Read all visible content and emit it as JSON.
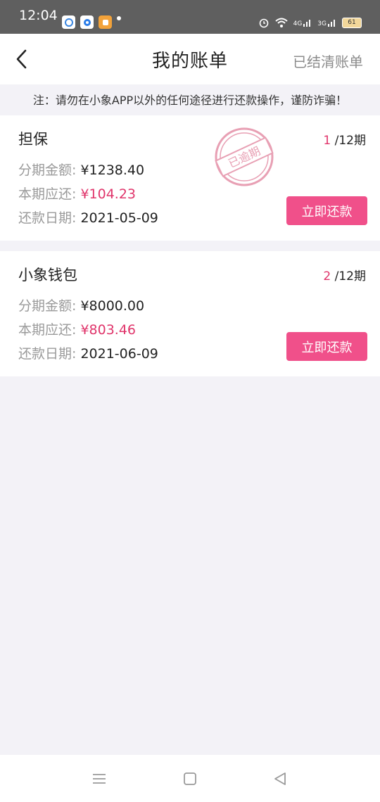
{
  "status_bar": {
    "time": "12:04",
    "signal_1": "4G",
    "signal_2": "3G",
    "battery": "61"
  },
  "header": {
    "title": "我的账单",
    "settled_link": "已结清账单"
  },
  "notice": "注：请勿在小象APP以外的任何途径进行还款操作，谨防诈骗！",
  "bills": [
    {
      "name": "担保",
      "current_term": "1",
      "total_term": "/12期",
      "installment_label": "分期金额:",
      "installment_amount": "¥1238.40",
      "due_label": "本期应还:",
      "due_amount": "¥104.23",
      "date_label": "还款日期:",
      "due_date": "2021-05-09",
      "button_label": "立即还款",
      "stamp_text": "已逾期"
    },
    {
      "name": "小象钱包",
      "current_term": "2",
      "total_term": "/12期",
      "installment_label": "分期金额:",
      "installment_amount": "¥8000.00",
      "due_label": "本期应还:",
      "due_amount": "¥803.46",
      "date_label": "还款日期:",
      "due_date": "2021-06-09",
      "button_label": "立即还款"
    }
  ],
  "colors": {
    "accent": "#f0508a",
    "highlight_text": "#e0356b",
    "stamp": "#e8a0b4"
  },
  "icons": [
    "back-arrow-icon",
    "menu-icon",
    "home-icon",
    "back-triangle-icon"
  ]
}
